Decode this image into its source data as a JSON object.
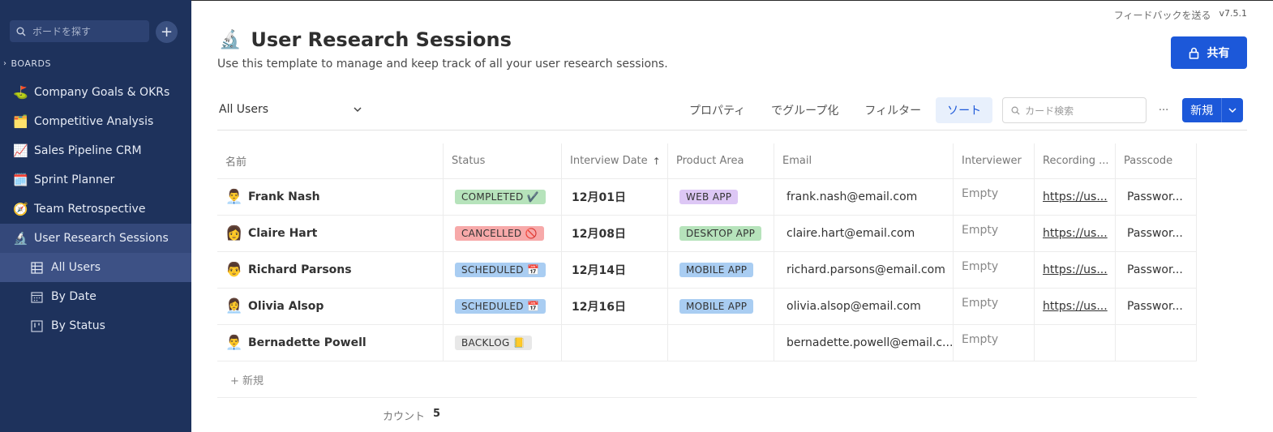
{
  "sidebar": {
    "search_placeholder": "ボードを探す",
    "add_label": "+",
    "boards_header": "BOARDS",
    "boards": [
      {
        "emoji": "⛳",
        "label": "Company Goals & OKRs"
      },
      {
        "emoji": "🗂️",
        "label": "Competitive Analysis"
      },
      {
        "emoji": "📈",
        "label": "Sales Pipeline CRM"
      },
      {
        "emoji": "🗓️",
        "label": "Sprint Planner"
      },
      {
        "emoji": "🧭",
        "label": "Team Retrospective"
      },
      {
        "emoji": "🔬",
        "label": "User Research Sessions"
      }
    ],
    "views": [
      {
        "label": "All Users",
        "icon": "table-icon"
      },
      {
        "label": "By Date",
        "icon": "calendar-icon"
      },
      {
        "label": "By Status",
        "icon": "board-icon"
      }
    ]
  },
  "header": {
    "feedback": "フィードバックを送る",
    "version": "v7.5.1",
    "share_label": "共有",
    "title_emoji": "🔬",
    "title": "User Research Sessions",
    "description": "Use this template to manage and keep track of all your user research sessions."
  },
  "toolbar": {
    "view_name": "All Users",
    "properties": "プロパティ",
    "group_by": "でグループ化",
    "filter": "フィルター",
    "sort": "ソート",
    "search_placeholder": "カード検索",
    "more": "···",
    "new_label": "新規"
  },
  "table": {
    "columns": [
      "名前",
      "Status",
      "Interview Date",
      "Product Area",
      "Email",
      "Interviewer",
      "Recording ...",
      "Passcode"
    ],
    "rows": [
      {
        "avatar": "👨‍💼",
        "name": "Frank Nash",
        "status": "COMPLETED ✔️",
        "status_class": "b-completed",
        "date": "12月01日",
        "area": "WEB APP",
        "area_class": "b-web",
        "email": "frank.nash@email.com",
        "interviewer": "Empty",
        "recording": "https://us...",
        "passcode": "Passwor..."
      },
      {
        "avatar": "👩",
        "name": "Claire Hart",
        "status": "CANCELLED 🚫",
        "status_class": "b-cancelled",
        "date": "12月08日",
        "area": "DESKTOP APP",
        "area_class": "b-desktop",
        "email": "claire.hart@email.com",
        "interviewer": "Empty",
        "recording": "https://us...",
        "passcode": "Passwor..."
      },
      {
        "avatar": "👨",
        "name": "Richard Parsons",
        "status": "SCHEDULED 📅",
        "status_class": "b-scheduled",
        "date": "12月14日",
        "area": "MOBILE APP",
        "area_class": "b-mobile",
        "email": "richard.parsons@email.com",
        "interviewer": "Empty",
        "recording": "https://us...",
        "passcode": "Passwor..."
      },
      {
        "avatar": "👩‍💼",
        "name": "Olivia Alsop",
        "status": "SCHEDULED 📅",
        "status_class": "b-scheduled",
        "date": "12月16日",
        "area": "MOBILE APP",
        "area_class": "b-mobile",
        "email": "olivia.alsop@email.com",
        "interviewer": "Empty",
        "recording": "https://us...",
        "passcode": "Passwor..."
      },
      {
        "avatar": "👨‍💼",
        "name": "Bernadette Powell",
        "status": "BACKLOG 📒",
        "status_class": "b-backlog",
        "date": "",
        "area": "",
        "area_class": "",
        "email": "bernadette.powell@email.c...",
        "interviewer": "Empty",
        "recording": "",
        "passcode": ""
      }
    ],
    "add_row": "+ 新規",
    "count_label": "カウント",
    "count_value": "5"
  }
}
